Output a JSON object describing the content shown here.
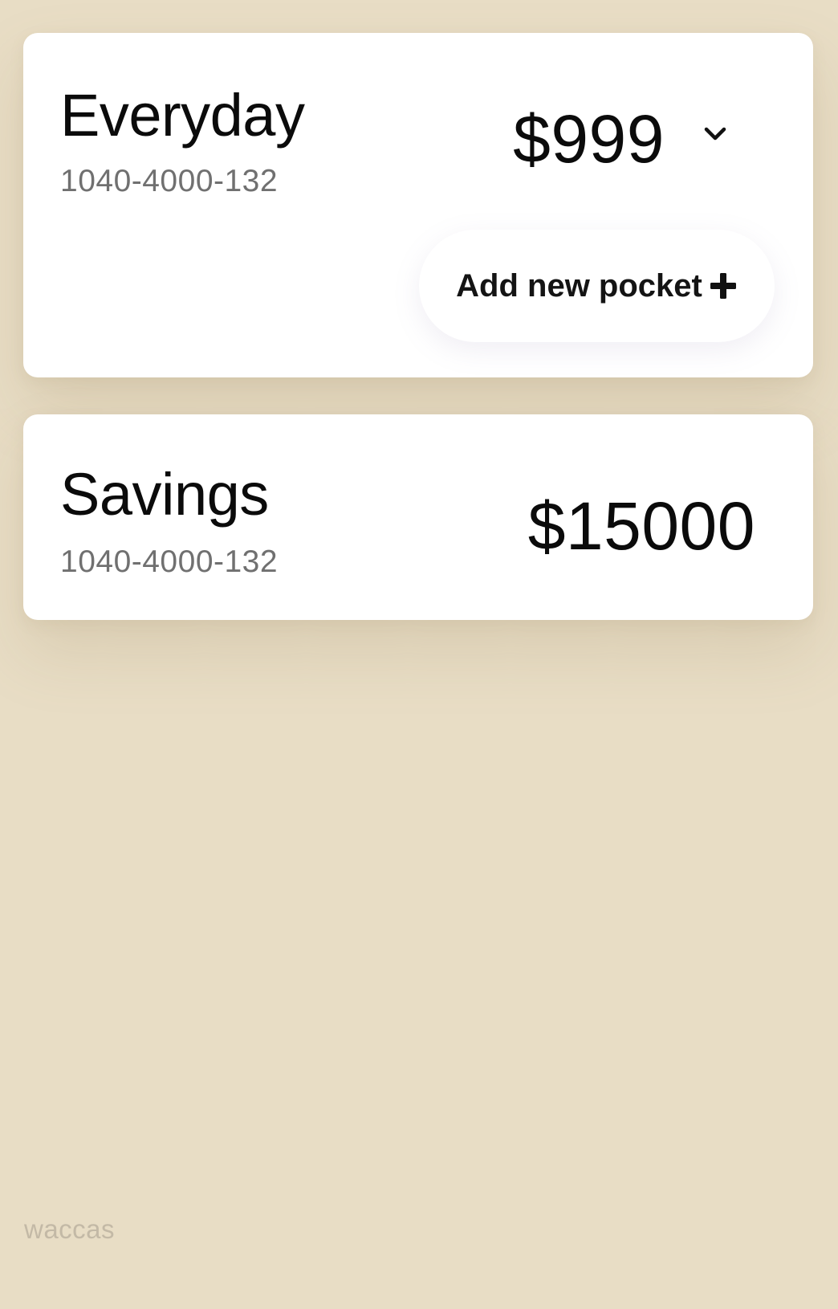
{
  "accounts": [
    {
      "name": "Everyday",
      "number": "1040-4000-132",
      "balance": "$999",
      "action_label": "Add new pocket"
    },
    {
      "name": "Savings",
      "number": "1040-4000-132",
      "balance": "$15000"
    }
  ],
  "watermark": "waccas",
  "icons": {
    "expand": "chevron-down-icon",
    "add": "plus-icon"
  },
  "colors": {
    "background": "#e8ddc5",
    "card": "#ffffff",
    "text": "#0b0b0b",
    "muted": "#707070"
  }
}
